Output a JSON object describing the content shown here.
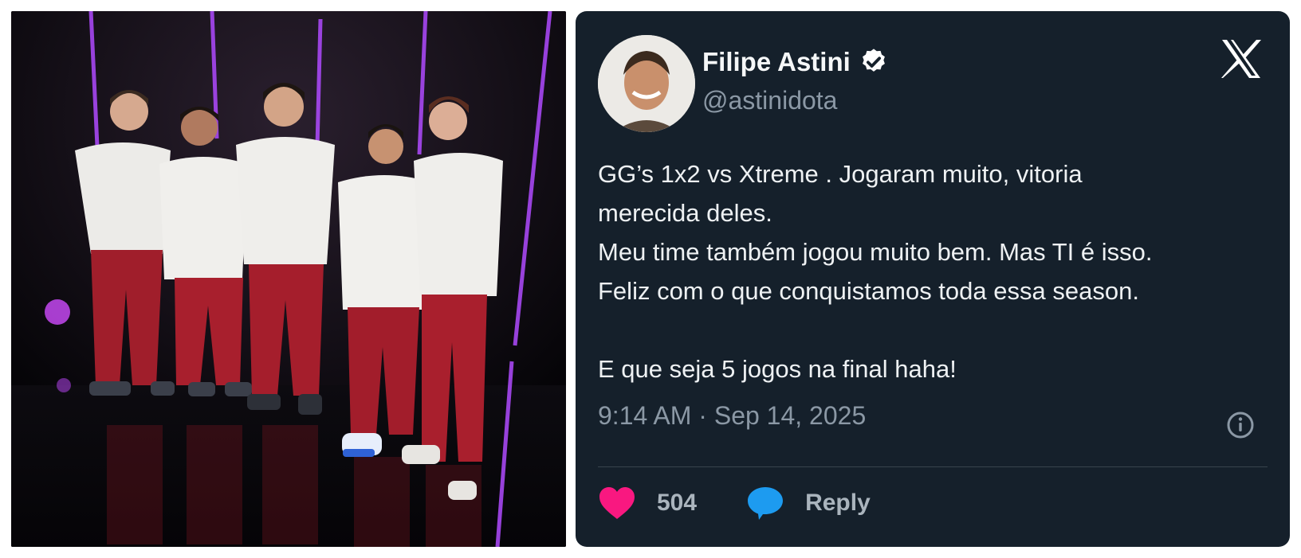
{
  "photo": {
    "description_icon": "team-photo"
  },
  "tweet": {
    "author_name": "Filipe Astini",
    "handle": "@astinidota",
    "text": "GG’s 1x2 vs Xtreme . Jogaram muito, vitoria\nmerecida deles.\nMeu time também jogou muito bem. Mas TI é isso.\nFeliz com o que conquistamos toda essa season.\n\nE que seja 5 jogos na final haha!",
    "timestamp": "9:14 AM · Sep 14, 2025",
    "likes": "504",
    "reply_label": "Reply"
  },
  "colors": {
    "card_bg": "#15202b",
    "heart": "#f91880",
    "reply_bubble": "#1d9bf0",
    "secondary_text": "#8b98a5"
  },
  "icons": {
    "verified": "verified-badge-icon",
    "x_logo": "x-logo-icon",
    "info": "info-icon",
    "like": "heart-icon",
    "reply": "speech-bubble-icon"
  }
}
